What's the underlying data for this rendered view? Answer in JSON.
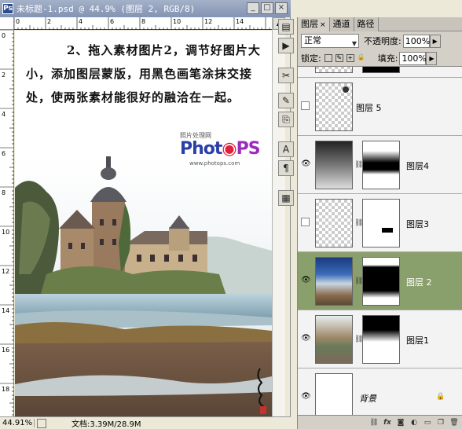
{
  "document": {
    "title": "未标题-1.psd @ 44.9% (图层 2, RGB/8)",
    "instruction": "2、拖入素材图片2，调节好图片大小，添加图层蒙版，用黑色画笔涂抹交接处，使两张素材能很好的融洽在一起。",
    "watermark_small": "照片处理网",
    "watermark_logo_a": "Phot",
    "watermark_logo_b": "PS",
    "watermark_url": "www.photops.com",
    "zoom": "44.91%",
    "doc_info": "文档:3.39M/28.9M",
    "ruler_top_marks": [
      "0",
      "2",
      "4",
      "6",
      "8",
      "10",
      "12",
      "14"
    ],
    "ruler_left_marks": [
      "0",
      "2",
      "4",
      "6",
      "8",
      "10",
      "12",
      "14",
      "16",
      "18"
    ]
  },
  "layers_panel": {
    "tabs": [
      {
        "label": "图层",
        "active": true
      },
      {
        "label": "通道",
        "active": false
      },
      {
        "label": "路径",
        "active": false
      }
    ],
    "blend_mode": "正常",
    "opacity_label": "不透明度:",
    "opacity_value": "100%",
    "lock_label": "锁定:",
    "fill_label": "填充:",
    "fill_value": "100%",
    "layers": [
      {
        "name": "图层 5",
        "visible": false,
        "has_mask": false,
        "selected": false
      },
      {
        "name": "图层4",
        "visible": true,
        "has_mask": true,
        "selected": false
      },
      {
        "name": "图层3",
        "visible": false,
        "has_mask": true,
        "selected": false
      },
      {
        "name": "图层 2",
        "visible": true,
        "has_mask": true,
        "selected": true
      },
      {
        "name": "图层1",
        "visible": true,
        "has_mask": true,
        "selected": false
      },
      {
        "name": "背景",
        "visible": true,
        "has_mask": false,
        "selected": false
      }
    ],
    "bottom_buttons": [
      "link-icon",
      "fx-icon",
      "mask-icon",
      "adjustment-icon",
      "folder-icon",
      "new-layer-icon",
      "trash-icon"
    ]
  },
  "colors": {
    "selected_layer": "#8aa06c",
    "title_bar": "#8393b3",
    "logo_blue": "#2b3fa8",
    "logo_red": "#e0203a",
    "logo_purple": "#9b2bbf"
  }
}
